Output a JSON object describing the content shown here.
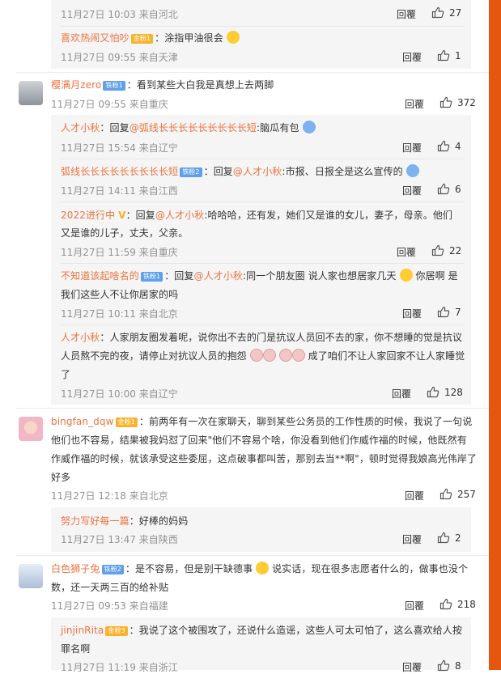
{
  "colors": {
    "accent": "#eb7340",
    "meta": "#939393",
    "reply_bg": "#f5f5f5",
    "side_bar": "#e5570f"
  },
  "comments": [
    {
      "type": "reply",
      "user": "",
      "text": "",
      "time": "11月27日 10:03 来自河北",
      "reply_label": "回覆",
      "likes": "27"
    },
    {
      "type": "reply",
      "user": "喜欢热闹又怕吵",
      "badge": "金粉1",
      "text": "：涂指甲油很会",
      "time": "11月27日 09:55 来自天津",
      "reply_label": "回覆",
      "likes": "1"
    },
    {
      "type": "main",
      "user": "樱满月zero",
      "badge": "铁粉1",
      "text": "：看到某些大白我是真想上去两脚",
      "time": "11月27日 09:55 来自重庆",
      "reply_label": "回覆",
      "likes": "372"
    },
    {
      "type": "reply",
      "user": "人才小秋",
      "text_prefix": "：回复",
      "mention": "@弧线长长长长长长长长长短",
      "text": ":脑瓜有包",
      "time": "11月27日 15:54 来自辽宁",
      "reply_label": "回覆",
      "likes": "4"
    },
    {
      "type": "reply",
      "user": "弧线长长长长长长长长长短",
      "badge": "铁粉2",
      "text_prefix": "：回复",
      "mention": "@人才小秋",
      "text": ":市报、日报全是这么宣传的",
      "time": "11月27日 14:11 来自江西",
      "reply_label": "回覆",
      "likes": "6"
    },
    {
      "type": "reply",
      "user": "2022进行中",
      "text_prefix": "：回复",
      "mention": "@人才小秋",
      "text": ":哈哈哈，还有发，她们又是谁的女儿，妻子，母亲。他们",
      "text2": "又是谁的儿子，丈夫，父亲。",
      "time": "11月27日 11:59 来自重庆",
      "reply_label": "回覆",
      "likes": "22"
    },
    {
      "type": "reply",
      "user": "不知道该起啥名的",
      "badge": "铁粉1",
      "text_prefix": "：回复",
      "mention": "@人才小秋",
      "text": ":同一个朋友圈 说人家也想居家几天",
      "text_after": "你居啊 是",
      "text2": "我们这些人不让你居家的吗",
      "time": "11月27日 10:11 来自北京",
      "reply_label": "回覆",
      "likes": "7"
    },
    {
      "type": "reply",
      "user": "人才小秋",
      "text": "：人家朋友圈发着呢，说你出不去的门是抗议人员回不去的家，你不想睡的觉是抗议",
      "text2": "人员熬不完的夜，请停止对抗议人员的抱怨",
      "text2_after": "成了咱们不让人家回家不让人家睡觉",
      "text3": "了",
      "time": "11月27日 10:00 来自辽宁",
      "reply_label": "回覆",
      "likes": "128"
    },
    {
      "type": "main",
      "user": "bingfan_dqw",
      "badge": "金粉1",
      "text": "：前两年有一次在家聊天，聊到某些公务员的工作性质的时候，我说了一句说",
      "text2": "他们也不容易，结果被我妈怼了回来\"他们不容易个啥，你没看到他们作威作福的时候，他既然有",
      "text3": "作威作福的时候，就该承受这些委屈，这点破事都叫苦，那别去当**啊\"，顿时觉得我娘高光伟岸了",
      "text4": "好多",
      "time": "11月27日 12:18 来自北京",
      "reply_label": "回覆",
      "likes": "257"
    },
    {
      "type": "reply",
      "user": "努力写好每一篇",
      "text": "：好棒的妈妈",
      "time": "11月27日 13:47 来自陕西",
      "reply_label": "回覆",
      "likes": "2"
    },
    {
      "type": "main",
      "user": "白色狮子兔",
      "badge": "铁粉2",
      "text": "：是不容易，但是别干缺德事",
      "text_after": "说实话，现在很多志愿者什么的，做事也没个",
      "text2": "数，还一天两三百的给补贴",
      "time": "11月27日 09:53 来自福建",
      "reply_label": "回覆",
      "likes": "218"
    },
    {
      "type": "reply",
      "user": "jinjinRita",
      "badge": "金粉3",
      "text": "：我说了这个被围攻了，还说什么造谣，这些人可太可怕了，这么喜欢给人按",
      "text2": "罪名啊",
      "time": "11月27日 11:19 来自浙江",
      "reply_label": "回覆",
      "likes": "8"
    }
  ]
}
